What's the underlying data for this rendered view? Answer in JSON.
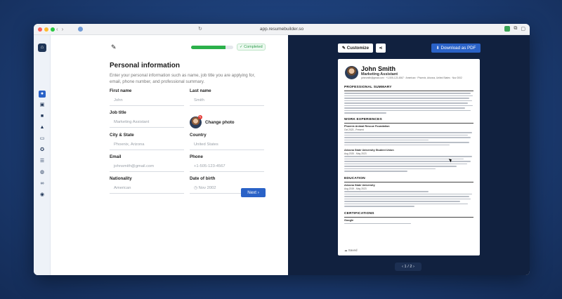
{
  "browser": {
    "url": "app.resumebuilder.so",
    "nav_back": "‹",
    "nav_forward": "›",
    "reload": "↻"
  },
  "progress": {
    "fraction": 0.82,
    "status": "Completed"
  },
  "form": {
    "title": "Personal information",
    "description": "Enter your personal information such as name, job title you are applying for, email, phone number, and professional summary.",
    "fields": {
      "first_name": {
        "label": "First name",
        "placeholder": "John"
      },
      "last_name": {
        "label": "Last name",
        "placeholder": "Smith"
      },
      "job_title": {
        "label": "Job title",
        "placeholder": "Marketing Assistant"
      },
      "city_state": {
        "label": "City & State",
        "placeholder": "Phoenix, Arizona"
      },
      "country": {
        "label": "Country",
        "placeholder": "United States"
      },
      "email": {
        "label": "Email",
        "placeholder": "johnsmith@gmail.com"
      },
      "phone": {
        "label": "Phone",
        "placeholder": "+1-505-123-4567"
      },
      "nationality": {
        "label": "Nationality",
        "placeholder": "American"
      },
      "dob": {
        "label": "Date of birth",
        "placeholder": "Nov 2002"
      }
    },
    "change_photo": "Change photo",
    "next": "Next"
  },
  "preview": {
    "customize": "Customize",
    "download": "Download as PDF",
    "pager": "1 / 2",
    "resume": {
      "name": "John Smith",
      "role": "Marketing Assistant",
      "contact": "johnsmith@gmail.com · +1-505-123-4567 · American · Phoenix, Arizona, United States · Nov 2002",
      "sections": {
        "summary": "PROFESSIONAL SUMMARY",
        "work": "WORK EXPERIENCES",
        "education": "EDUCATION",
        "certs": "CERTIFICATIONS"
      },
      "job1_org": "Phoenix Animal Rescue Foundation",
      "job1_sub": "Oct 2023 - Present",
      "job2_org": "Arizona State University Student Union",
      "job2_sub": "Aug 2020 - May 2023",
      "edu_org": "Arizona State University",
      "edu_sub": "Aug 2019 - May 2023",
      "cert_org": "Google"
    },
    "saved": "Saved"
  }
}
